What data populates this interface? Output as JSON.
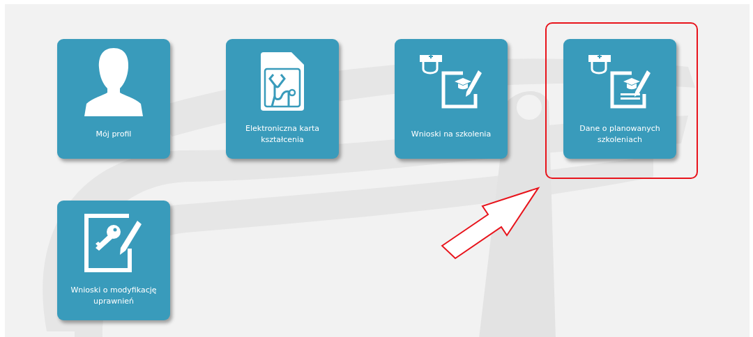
{
  "tiles": [
    {
      "kind": "profile",
      "label": "Mój profil",
      "highlighted": false
    },
    {
      "kind": "card",
      "label": "Elektroniczna karta kształcenia",
      "highlighted": false
    },
    {
      "kind": "training",
      "label": "Wnioski na szkolenia",
      "highlighted": false
    },
    {
      "kind": "planned",
      "label": "Dane o planowanych szkoleniach",
      "highlighted": true
    },
    {
      "kind": "permissions",
      "label": "Wnioski o modyfikację uprawnień",
      "highlighted": false
    }
  ]
}
